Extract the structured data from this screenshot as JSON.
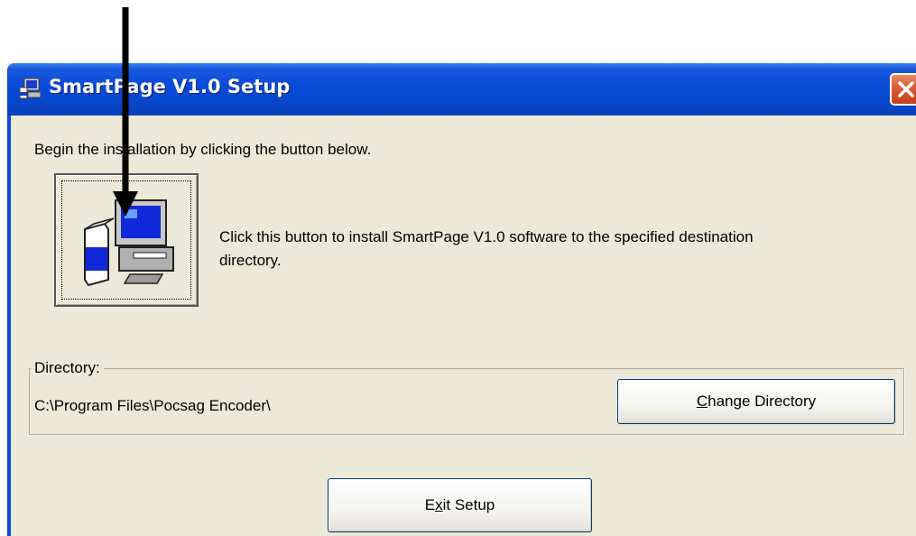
{
  "window": {
    "title": "SmartPage V1.0 Setup"
  },
  "intro_text": "Begin the installation by clicking the button below.",
  "install": {
    "description": "Click this button to install SmartPage V1.0 software to the specified destination directory."
  },
  "directory": {
    "label": "Directory:",
    "path": "C:\\Program Files\\Pocsag Encoder\\",
    "change_button": {
      "mnemonic": "C",
      "rest": "hange Directory"
    }
  },
  "exit_button": {
    "prefix": "E",
    "mnemonic": "x",
    "rest": "it Setup"
  },
  "colors": {
    "titlebar": "#0a4ad8",
    "dialog_bg": "#ece9d8",
    "close_button": "#d9582f"
  },
  "icons": [
    "setup-app-icon",
    "close-icon",
    "install-computer-icon",
    "annotation-arrow"
  ]
}
